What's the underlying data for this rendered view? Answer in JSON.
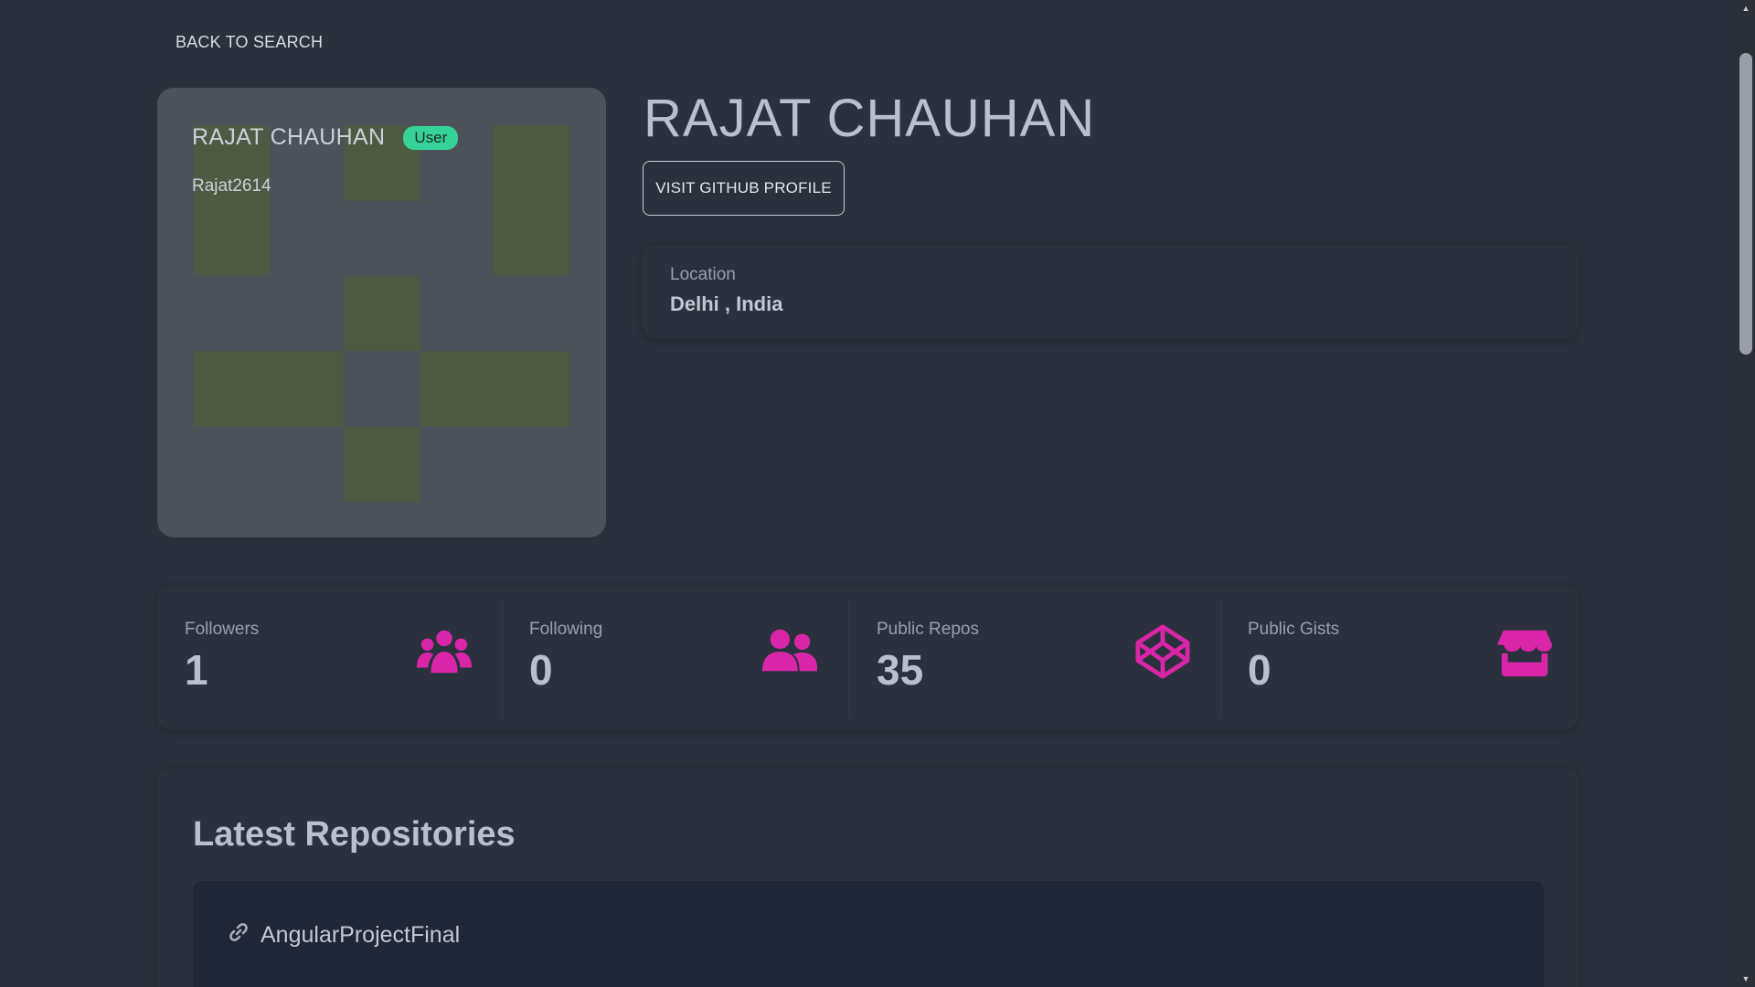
{
  "nav": {
    "back_label": "BACK TO SEARCH"
  },
  "avatar": {
    "name": "RAJAT CHAUHAN",
    "badge": "User",
    "login": "Rajat2614"
  },
  "profile": {
    "name": "RAJAT CHAUHAN",
    "visit_label": "VISIT GITHUB PROFILE"
  },
  "location": {
    "label": "Location",
    "value": "Delhi , India"
  },
  "stats": [
    {
      "title": "Followers",
      "value": "1",
      "icon": "users-group-icon"
    },
    {
      "title": "Following",
      "value": "0",
      "icon": "user-friends-icon"
    },
    {
      "title": "Public Repos",
      "value": "35",
      "icon": "codepen-icon"
    },
    {
      "title": "Public Gists",
      "value": "0",
      "icon": "store-icon"
    }
  ],
  "repos": {
    "title": "Latest Repositories",
    "items": [
      {
        "name": "AngularProjectFinal"
      }
    ]
  },
  "colors": {
    "background": "#2a303c",
    "accent_icon": "#d926a9",
    "badge": "#36d399",
    "identicon_fill": "#4e5a42",
    "identicon_bg": "#4d5159"
  }
}
